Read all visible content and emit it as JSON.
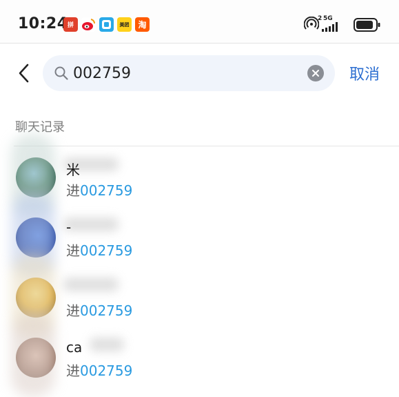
{
  "status_bar": {
    "time": "10:24",
    "apps": [
      {
        "icon": "pinduoduo-icon",
        "glyph": "拼",
        "color": "#e0402b"
      },
      {
        "icon": "weibo-icon",
        "glyph": "",
        "color": "#e6162d"
      },
      {
        "icon": "book-icon",
        "glyph": "",
        "color": "#29a9e8"
      },
      {
        "icon": "meituan-icon",
        "glyph": "美团",
        "color": "#ffd11a"
      },
      {
        "icon": "taobao-icon",
        "glyph": "淘",
        "color": "#ff5a00"
      }
    ],
    "sim_label": "2",
    "network_label": "5G"
  },
  "search": {
    "query": "002759",
    "cancel_label": "取消"
  },
  "section": {
    "title": "聊天记录"
  },
  "results": [
    {
      "name": "米",
      "prefix": "进",
      "keyword": "002759"
    },
    {
      "name": "-",
      "prefix": "进",
      "keyword": "002759"
    },
    {
      "name": "",
      "prefix": "进",
      "keyword": "002759"
    },
    {
      "name": "ca",
      "prefix": "进",
      "keyword": "002759"
    }
  ],
  "colors": {
    "accent": "#2d6fd1",
    "keyword_highlight": "#2a9ae0",
    "search_bg": "#f0f4fb"
  }
}
